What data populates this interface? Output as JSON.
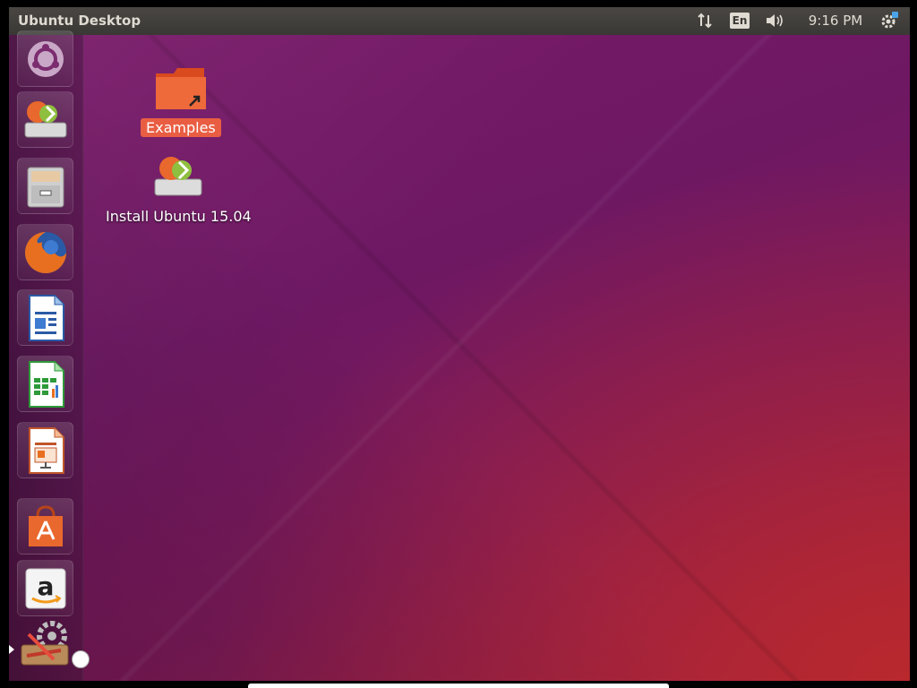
{
  "panel": {
    "title": "Ubuntu Desktop",
    "lang": "En",
    "clock": "9:16 PM"
  },
  "launcher": {
    "items": [
      {
        "name": "dash-home",
        "icon": "ubuntu-logo-icon"
      },
      {
        "name": "install-ubuntu",
        "icon": "installer-icon"
      },
      {
        "name": "files",
        "icon": "file-cabinet-icon"
      },
      {
        "name": "firefox",
        "icon": "firefox-icon"
      },
      {
        "name": "libreoffice-writer",
        "icon": "writer-document-icon"
      },
      {
        "name": "libreoffice-calc",
        "icon": "calc-spreadsheet-icon"
      },
      {
        "name": "libreoffice-impress",
        "icon": "impress-presentation-icon"
      },
      {
        "name": "ubuntu-software-center",
        "icon": "software-bag-icon"
      },
      {
        "name": "amazon",
        "icon": "amazon-icon"
      },
      {
        "name": "system-settings",
        "icon": "settings-tools-icon"
      }
    ]
  },
  "desktop": {
    "icons": [
      {
        "label": "Examples",
        "icon": "folder-link-icon",
        "selected": true
      },
      {
        "label": "Install Ubuntu 15.04",
        "icon": "installer-icon",
        "selected": false
      }
    ]
  },
  "colors": {
    "accent": "#e95e43",
    "panel_bg": "#3c3b37",
    "wallpaper_purple": "#6e1863",
    "wallpaper_red": "#b8282d"
  }
}
